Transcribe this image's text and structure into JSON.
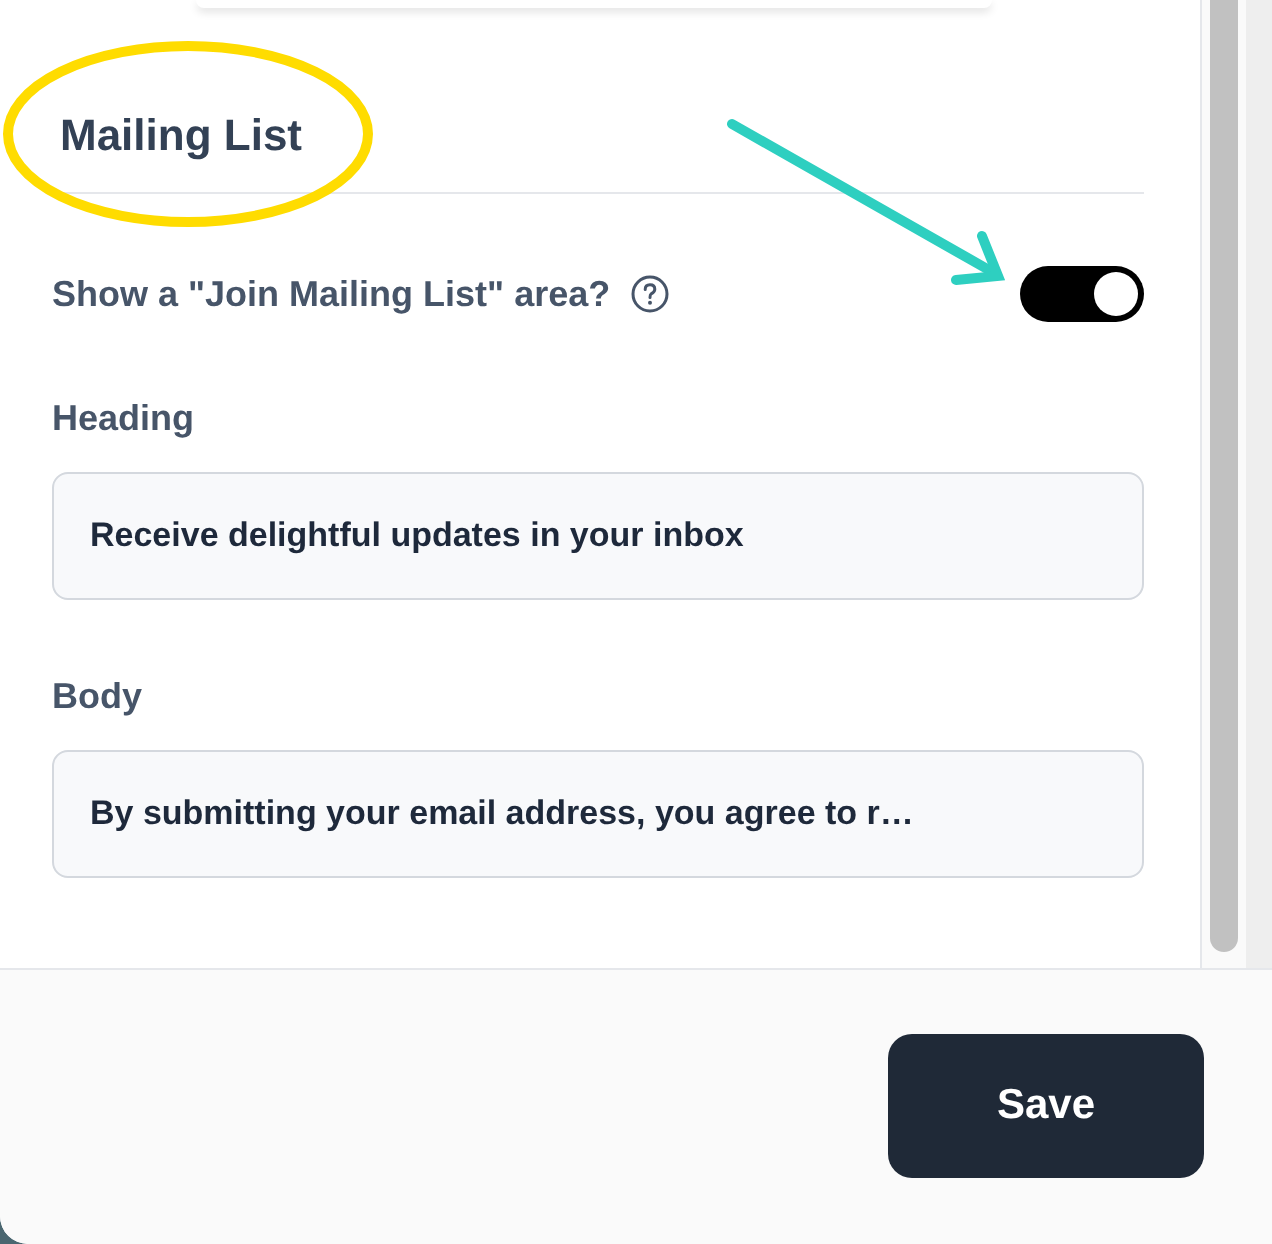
{
  "section": {
    "title": "Mailing List"
  },
  "toggle": {
    "label": "Show a \"Join Mailing List\" area?",
    "on": true
  },
  "fields": [
    {
      "label": "Heading",
      "value": "Receive delightful updates in your inbox"
    },
    {
      "label": "Body",
      "value": "By submitting your email address, you agree to r…"
    }
  ],
  "buttons": [
    {
      "label": "Save"
    }
  ]
}
